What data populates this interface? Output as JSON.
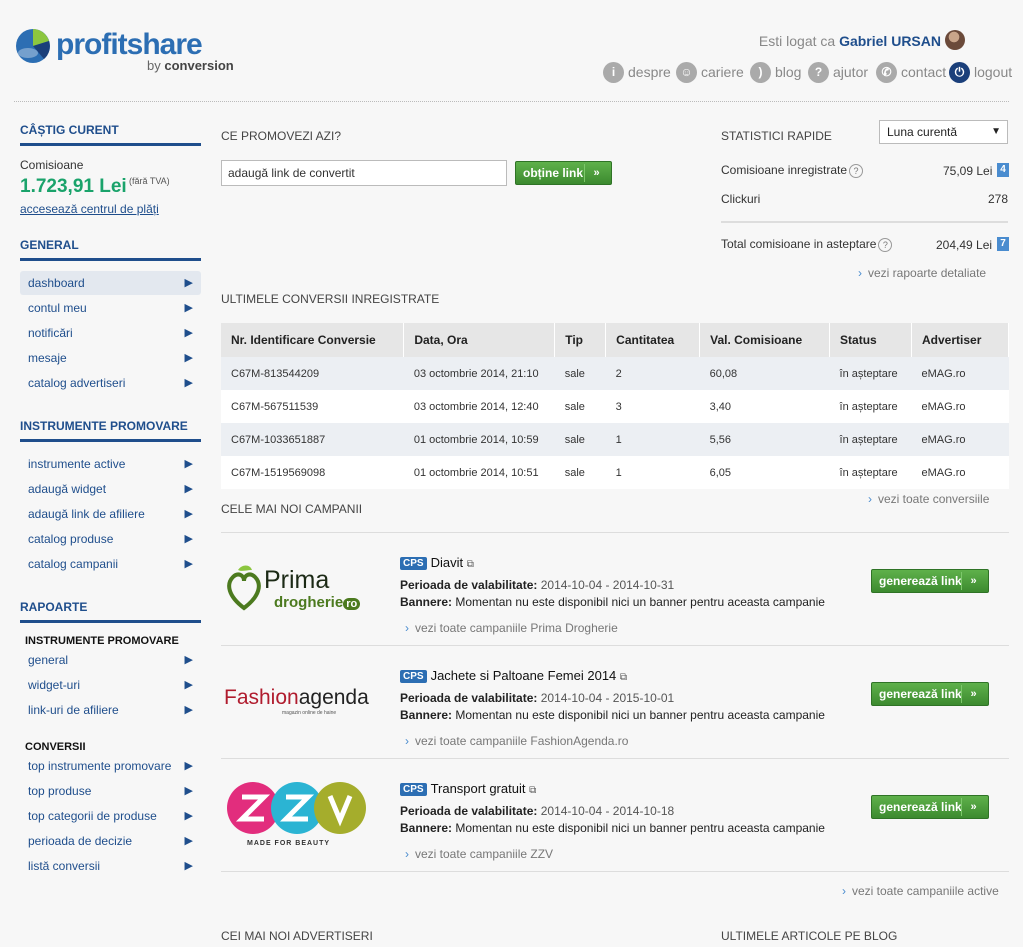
{
  "header": {
    "logo_main": "profitshare",
    "logo_by": "by",
    "logo_conv": "conversion",
    "logged_prefix": "Esti logat ca",
    "user_name": "Gabriel URSAN",
    "nav": [
      {
        "label": "despre",
        "icon": "info-icon"
      },
      {
        "label": "cariere",
        "icon": "users-icon"
      },
      {
        "label": "blog",
        "icon": "rss-icon"
      },
      {
        "label": "ajutor",
        "icon": "help-icon"
      },
      {
        "label": "contact",
        "icon": "phone-icon"
      },
      {
        "label": "logout",
        "icon": "power-icon"
      }
    ]
  },
  "sidebar": {
    "earnings_title": "CÂȘTIG CURENT",
    "commissions_label": "Comisioane",
    "commissions_value": "1.723,91 Lei",
    "vat_note": "(fără TVA)",
    "payments_link": "accesează centrul de plăți",
    "general_title": "GENERAL",
    "general_items": [
      "dashboard",
      "contul meu",
      "notificări",
      "mesaje",
      "catalog advertiseri"
    ],
    "tools_title": "INSTRUMENTE PROMOVARE",
    "tools_items": [
      "instrumente active",
      "adaugă widget",
      "adaugă link de afiliere",
      "catalog produse",
      "catalog campanii"
    ],
    "reports_title": "RAPOARTE",
    "reports_sub1": "INSTRUMENTE PROMOVARE",
    "reports_items1": [
      "general",
      "widget-uri",
      "link-uri de afiliere"
    ],
    "reports_sub2": "CONVERSII",
    "reports_items2": [
      "top instrumente promovare",
      "top produse",
      "top categorii de produse",
      "perioada de decizie",
      "listă conversii"
    ]
  },
  "promo": {
    "title": "CE PROMOVEZI AZI?",
    "input_value": "adaugă link de convertit",
    "button": "obține link"
  },
  "stats": {
    "title": "STATISTICI RAPIDE",
    "period": "Luna curentă",
    "rows": [
      {
        "label": "Comisioane inregistrate",
        "value": "75,09 Lei",
        "badge": "4"
      },
      {
        "label": "Clickuri",
        "value": "278"
      }
    ],
    "total_label": "Total comisioane in asteptare",
    "total_value": "204,49 Lei",
    "total_badge": "7",
    "more": "vezi rapoarte detaliate"
  },
  "conversions": {
    "title": "ULTIMELE CONVERSII INREGISTRATE",
    "columns": [
      "Nr. Identificare Conversie",
      "Data, Ora",
      "Tip",
      "Cantitatea",
      "Val. Comisioane",
      "Status",
      "Advertiser"
    ],
    "rows": [
      [
        "C67M-813544209",
        "03 octombrie 2014, 21:10",
        "sale",
        "2",
        "60,08",
        "în așteptare",
        "eMAG.ro"
      ],
      [
        "C67M-567511539",
        "03 octombrie 2014, 12:40",
        "sale",
        "3",
        "3,40",
        "în așteptare",
        "eMAG.ro"
      ],
      [
        "C67M-1033651887",
        "01 octombrie 2014, 10:59",
        "sale",
        "1",
        "5,56",
        "în așteptare",
        "eMAG.ro"
      ],
      [
        "C67M-1519569098",
        "01 octombrie 2014, 10:51",
        "sale",
        "1",
        "6,05",
        "în așteptare",
        "eMAG.ro"
      ]
    ],
    "more": "vezi toate conversiile"
  },
  "campaigns": {
    "title": "CELE MAI NOI CAMPANII",
    "badge": "CPS",
    "period_label": "Perioada de valabilitate:",
    "banners_label": "Bannere:",
    "button": "generează link",
    "items": [
      {
        "logo_a": "Prima",
        "logo_b": "drogherie",
        "logo_c": "ro",
        "name": "Diavit",
        "period": "2014-10-04 - 2014-10-31",
        "banners": "Momentan nu este disponibil nici un banner pentru aceasta campanie",
        "more": "vezi toate campaniile Prima Drogherie"
      },
      {
        "logo_a": "Fashion",
        "logo_b": "agenda",
        "logo_c": "magazin online de haine",
        "name": "Jachete si Paltoane Femei 2014",
        "period": "2014-10-04 - 2015-10-01",
        "banners": "Momentan nu este disponibil nici un banner pentru aceasta campanie",
        "more": "vezi toate campaniile FashionAgenda.ro"
      },
      {
        "logo_a": "MADE FOR BEAUTY",
        "logo_b": "",
        "logo_c": "",
        "name": "Transport gratuit",
        "period": "2014-10-04 - 2014-10-18",
        "banners": "Momentan nu este disponibil nici un banner pentru aceasta campanie",
        "more": "vezi toate campaniile ZZV"
      }
    ],
    "more_all": "vezi toate campaniile active"
  },
  "footer": {
    "advertisers_title": "CEI MAI NOI ADVERTISERI",
    "blog_title": "ULTIMELE ARTICOLE PE BLOG"
  },
  "colors": {
    "brand": "#2c6eb3",
    "accent_green": "#3c8a2f",
    "earnings_green": "#1aa36b"
  }
}
